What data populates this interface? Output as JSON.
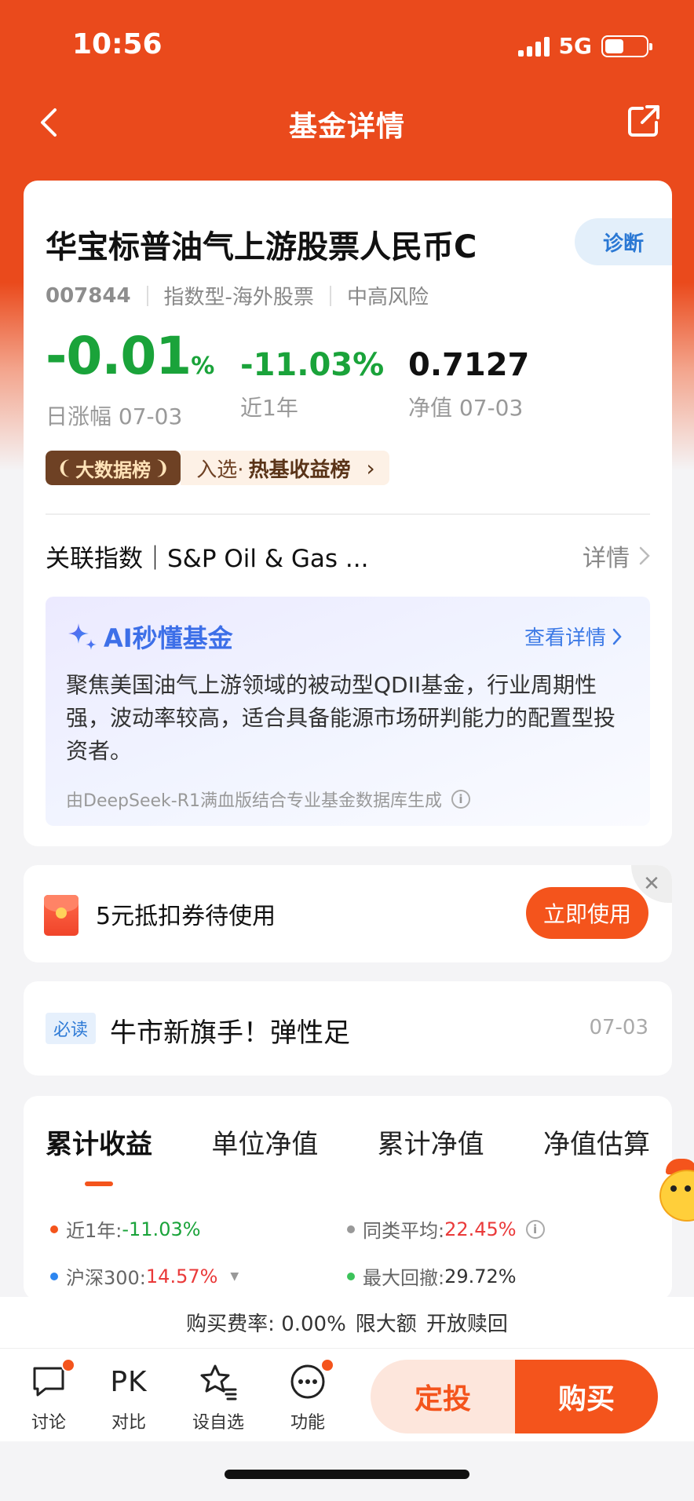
{
  "status_bar": {
    "time": "10:56",
    "network": "5G",
    "battery_level": 0.45
  },
  "nav": {
    "title": "基金详情"
  },
  "fund": {
    "name": "华宝标普油气上游股票人民币C",
    "diagnose_label": "诊断",
    "code": "007844",
    "type": "指数型-海外股票",
    "risk": "中高风险"
  },
  "stats": {
    "daily_change": {
      "value": "-0.01",
      "unit": "%",
      "label": "日涨幅 07-03"
    },
    "one_year": {
      "value": "-11.03%",
      "label": "近1年"
    },
    "nav": {
      "value": "0.7127",
      "label": "净值 07-03"
    }
  },
  "ranking": {
    "badge": "大数据榜",
    "prefix": "入选·",
    "name": "热基收益榜"
  },
  "related_index": {
    "text": "关联指数｜S&P Oil & Gas ...",
    "detail_label": "详情"
  },
  "ai": {
    "title": "AI秒懂基金",
    "more_label": "查看详情",
    "summary": "聚焦美国油气上游领域的被动型QDII基金，行业周期性强，波动率较高，适合具备能源市场研判能力的配置型投资者。",
    "footer": "由DeepSeek-R1满血版结合专业基金数据库生成"
  },
  "coupon": {
    "text": "5元抵扣券待使用",
    "button": "立即使用"
  },
  "news": {
    "tag": "必读",
    "title": "牛市新旗手！弹性足",
    "date": "07-03"
  },
  "performance": {
    "tabs": [
      {
        "label": "累计收益",
        "active": true
      },
      {
        "label": "单位净值",
        "active": false
      },
      {
        "label": "累计净值",
        "active": false
      },
      {
        "label": "净值估算",
        "active": false
      }
    ],
    "legend": [
      {
        "label": "近1年:",
        "value": "-11.03%",
        "color": "#f4541c",
        "value_color": "#1aa33a"
      },
      {
        "label": "同类平均:",
        "value": "22.45%",
        "color": "#999999",
        "value_color": "#ea3a3a"
      },
      {
        "label": "沪深300:",
        "value": "14.57%",
        "color": "#2d86f0",
        "value_color": "#ea3a3a"
      },
      {
        "label": "最大回撤:",
        "value": "29.72%",
        "color": "#3cc35a",
        "value_color": "#333333"
      }
    ]
  },
  "fee": {
    "rate_label": "购买费率:",
    "rate": "0.00%",
    "limit": "限大额",
    "redeem": "开放赎回"
  },
  "bottom_nav": {
    "items": [
      {
        "label": "讨论",
        "icon": "chat-icon"
      },
      {
        "label": "对比",
        "icon": "pk-icon",
        "icon_text": "PK"
      },
      {
        "label": "设自选",
        "icon": "star-list-icon"
      },
      {
        "label": "功能",
        "icon": "more-icon"
      }
    ],
    "invest_button": "定投",
    "buy_button": "购买"
  },
  "colors": {
    "brand": "#f4541c",
    "header": "#ea4a1c",
    "rise": "#ea3a3a",
    "fall": "#1aa33a"
  }
}
